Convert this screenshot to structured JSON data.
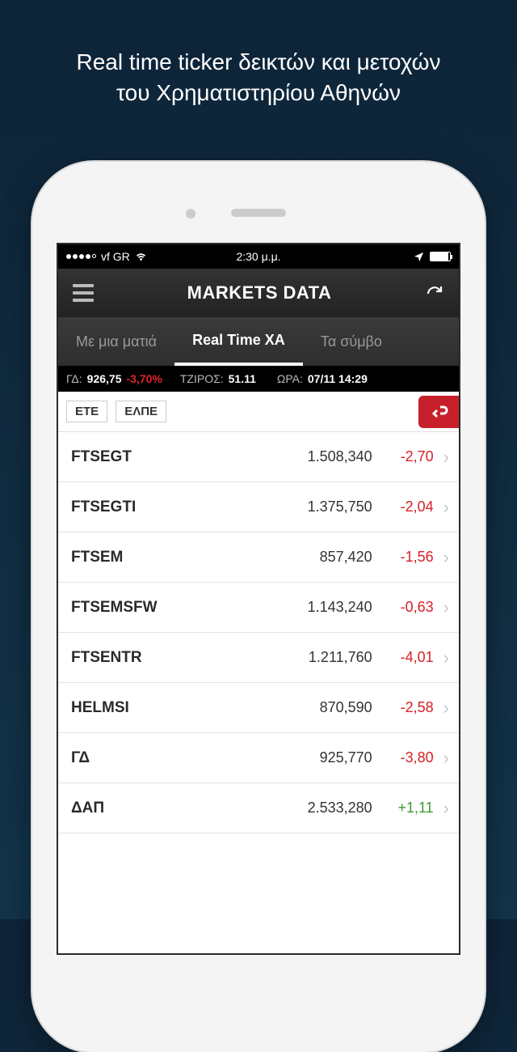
{
  "promo": {
    "line1": "Real time ticker δεικτών και μετοχών",
    "line2": "του Χρηματιστηρίου Αθηνών"
  },
  "status": {
    "carrier": "vf GR",
    "time": "2:30 μ.μ."
  },
  "nav": {
    "title": "MARKETS DATA"
  },
  "tabs": [
    {
      "label": "Με μια ματιά",
      "active": false
    },
    {
      "label": "Real Time XA",
      "active": true
    },
    {
      "label": "Τα σύμβο",
      "active": false
    }
  ],
  "info": {
    "gdLabel": "ΓΔ:",
    "gdValue": "926,75",
    "gdChange": "-3,70%",
    "tzirosLabel": "ΤΖΙΡΟΣ:",
    "tzirosValue": "51.11",
    "oraLabel": "ΩΡΑ:",
    "oraValue": "07/11 14:29"
  },
  "chips": [
    "ΕΤΕ",
    "ΕΛΠΕ"
  ],
  "rows": [
    {
      "symbol": "FTSEGT",
      "price": "1.508,340",
      "change": "-2,70",
      "dir": "neg"
    },
    {
      "symbol": "FTSEGTI",
      "price": "1.375,750",
      "change": "-2,04",
      "dir": "neg"
    },
    {
      "symbol": "FTSEM",
      "price": "857,420",
      "change": "-1,56",
      "dir": "neg"
    },
    {
      "symbol": "FTSEMSFW",
      "price": "1.143,240",
      "change": "-0,63",
      "dir": "neg"
    },
    {
      "symbol": "FTSENTR",
      "price": "1.211,760",
      "change": "-4,01",
      "dir": "neg"
    },
    {
      "symbol": "HELMSI",
      "price": "870,590",
      "change": "-2,58",
      "dir": "neg"
    },
    {
      "symbol": "ΓΔ",
      "price": "925,770",
      "change": "-3,80",
      "dir": "neg"
    },
    {
      "symbol": "ΔΑΠ",
      "price": "2.533,280",
      "change": "+1,11",
      "dir": "pos"
    }
  ]
}
